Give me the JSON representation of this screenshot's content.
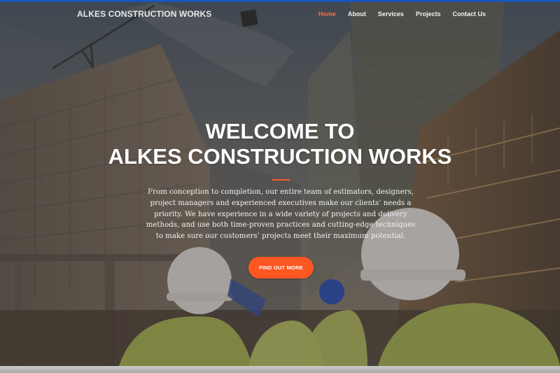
{
  "brand": {
    "name": "ALKES CONSTRUCTION WORKS"
  },
  "nav": {
    "items": [
      {
        "label": "Home",
        "active": true
      },
      {
        "label": "About",
        "active": false
      },
      {
        "label": "Services",
        "active": false
      },
      {
        "label": "Projects",
        "active": false
      },
      {
        "label": "Contact Us",
        "active": false
      }
    ]
  },
  "hero": {
    "title_line1": "WELCOME TO",
    "title_line2": "ALKES CONSTRUCTION WORKS",
    "description": "From conception to completion, our entire team of estimators, designers, project managers and experienced executives make our clients’ needs a priority. We have experience in a wide variety of projects and delivery methods, and use both time-proven practices and cutting-edge techniques to make sure our customers’ projects meet their maximum potential.",
    "cta_label": "FIND OUT MORE"
  },
  "colors": {
    "accent": "#ff5722",
    "active_nav": "#ff6a3d",
    "top_border": "#1a56b8"
  },
  "icons": {
    "hero_image": "construction-site-photo"
  }
}
